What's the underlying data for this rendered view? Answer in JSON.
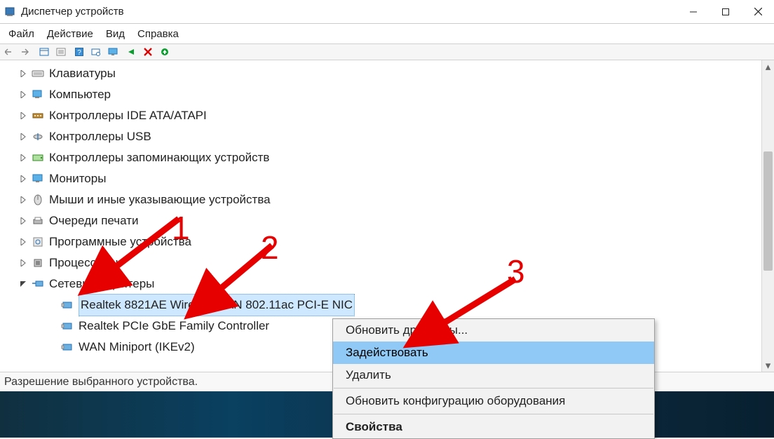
{
  "window": {
    "title": "Диспетчер устройств"
  },
  "menubar": [
    "Файл",
    "Действие",
    "Вид",
    "Справка"
  ],
  "tree": [
    {
      "label": "Клавиатуры",
      "expanded": false,
      "level": 1,
      "icon": "keyboard-icon"
    },
    {
      "label": "Компьютер",
      "expanded": false,
      "level": 1,
      "icon": "computer-icon"
    },
    {
      "label": "Контроллеры IDE ATA/ATAPI",
      "expanded": false,
      "level": 1,
      "icon": "ide-icon"
    },
    {
      "label": "Контроллеры USB",
      "expanded": false,
      "level": 1,
      "icon": "usb-icon"
    },
    {
      "label": "Контроллеры запоминающих устройств",
      "expanded": false,
      "level": 1,
      "icon": "storage-icon"
    },
    {
      "label": "Мониторы",
      "expanded": false,
      "level": 1,
      "icon": "monitor-icon"
    },
    {
      "label": "Мыши и иные указывающие устройства",
      "expanded": false,
      "level": 1,
      "icon": "mouse-icon"
    },
    {
      "label": "Очереди печати",
      "expanded": false,
      "level": 1,
      "icon": "printer-icon"
    },
    {
      "label": "Программные устройства",
      "expanded": false,
      "level": 1,
      "icon": "software-icon"
    },
    {
      "label": "Процессоры",
      "expanded": false,
      "level": 1,
      "icon": "cpu-icon"
    },
    {
      "label": "Сетевые адаптеры",
      "expanded": true,
      "level": 1,
      "icon": "network-icon"
    },
    {
      "label": "Realtek 8821AE Wireless LAN 802.11ac PCI-E NIC",
      "level": 2,
      "icon": "nic-icon",
      "selected": true
    },
    {
      "label": "Realtek PCIe GbE Family Controller",
      "level": 2,
      "icon": "nic-icon"
    },
    {
      "label": "WAN Miniport (IKEv2)",
      "level": 2,
      "icon": "nic-icon"
    }
  ],
  "context_menu": {
    "items": [
      {
        "label": "Обновить драйверы...",
        "highlight": false
      },
      {
        "label": "Задействовать",
        "highlight": true
      },
      {
        "label": "Удалить",
        "highlight": false
      },
      {
        "sep": true
      },
      {
        "label": "Обновить конфигурацию оборудования",
        "highlight": false
      },
      {
        "sep": true
      },
      {
        "label": "Свойства",
        "highlight": false,
        "bold": true
      }
    ]
  },
  "status": "Разрешение выбранного устройства.",
  "annotations": {
    "1": "1",
    "2": "2",
    "3": "3"
  }
}
